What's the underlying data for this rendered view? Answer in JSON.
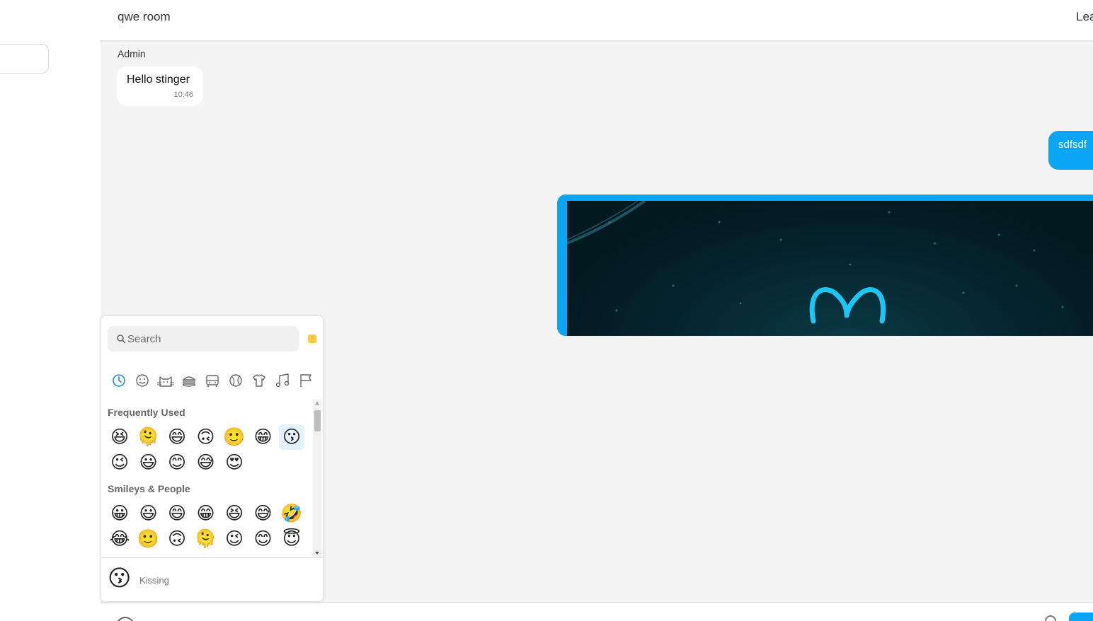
{
  "header": {
    "room_title": "qwe room",
    "leave_label": "Lea"
  },
  "messages": {
    "incoming": {
      "sender": "Admin",
      "text": "Hello stinger",
      "time": "10:46"
    },
    "outgoing": {
      "text": "sdfsdf"
    }
  },
  "picker": {
    "search_placeholder": "Search",
    "categories": [
      "recent-icon",
      "smiley-icon",
      "cat-icon",
      "food-icon",
      "bus-icon",
      "ball-icon",
      "shirt-icon",
      "music-icon",
      "flag-icon"
    ],
    "frequent_title": "Frequently Used",
    "frequent": [
      "😆",
      "🫠",
      "😄",
      "🙃",
      "🙂",
      "😁",
      "😗",
      "😉",
      "😃",
      "😊",
      "😅",
      "😍"
    ],
    "smileys_title": "Smileys & People",
    "smileys": [
      "😀",
      "😃",
      "😄",
      "😁",
      "😆",
      "😅",
      "🤣",
      "😂",
      "🙂",
      "🙃",
      "🫠",
      "😉",
      "😊",
      "😇"
    ],
    "preview_emoji": "😗",
    "preview_name": "Kissing"
  },
  "colors": {
    "accent": "#0aa6f5",
    "chat_bg": "#f4f4f4",
    "skin_tone": "#ffc83d"
  }
}
